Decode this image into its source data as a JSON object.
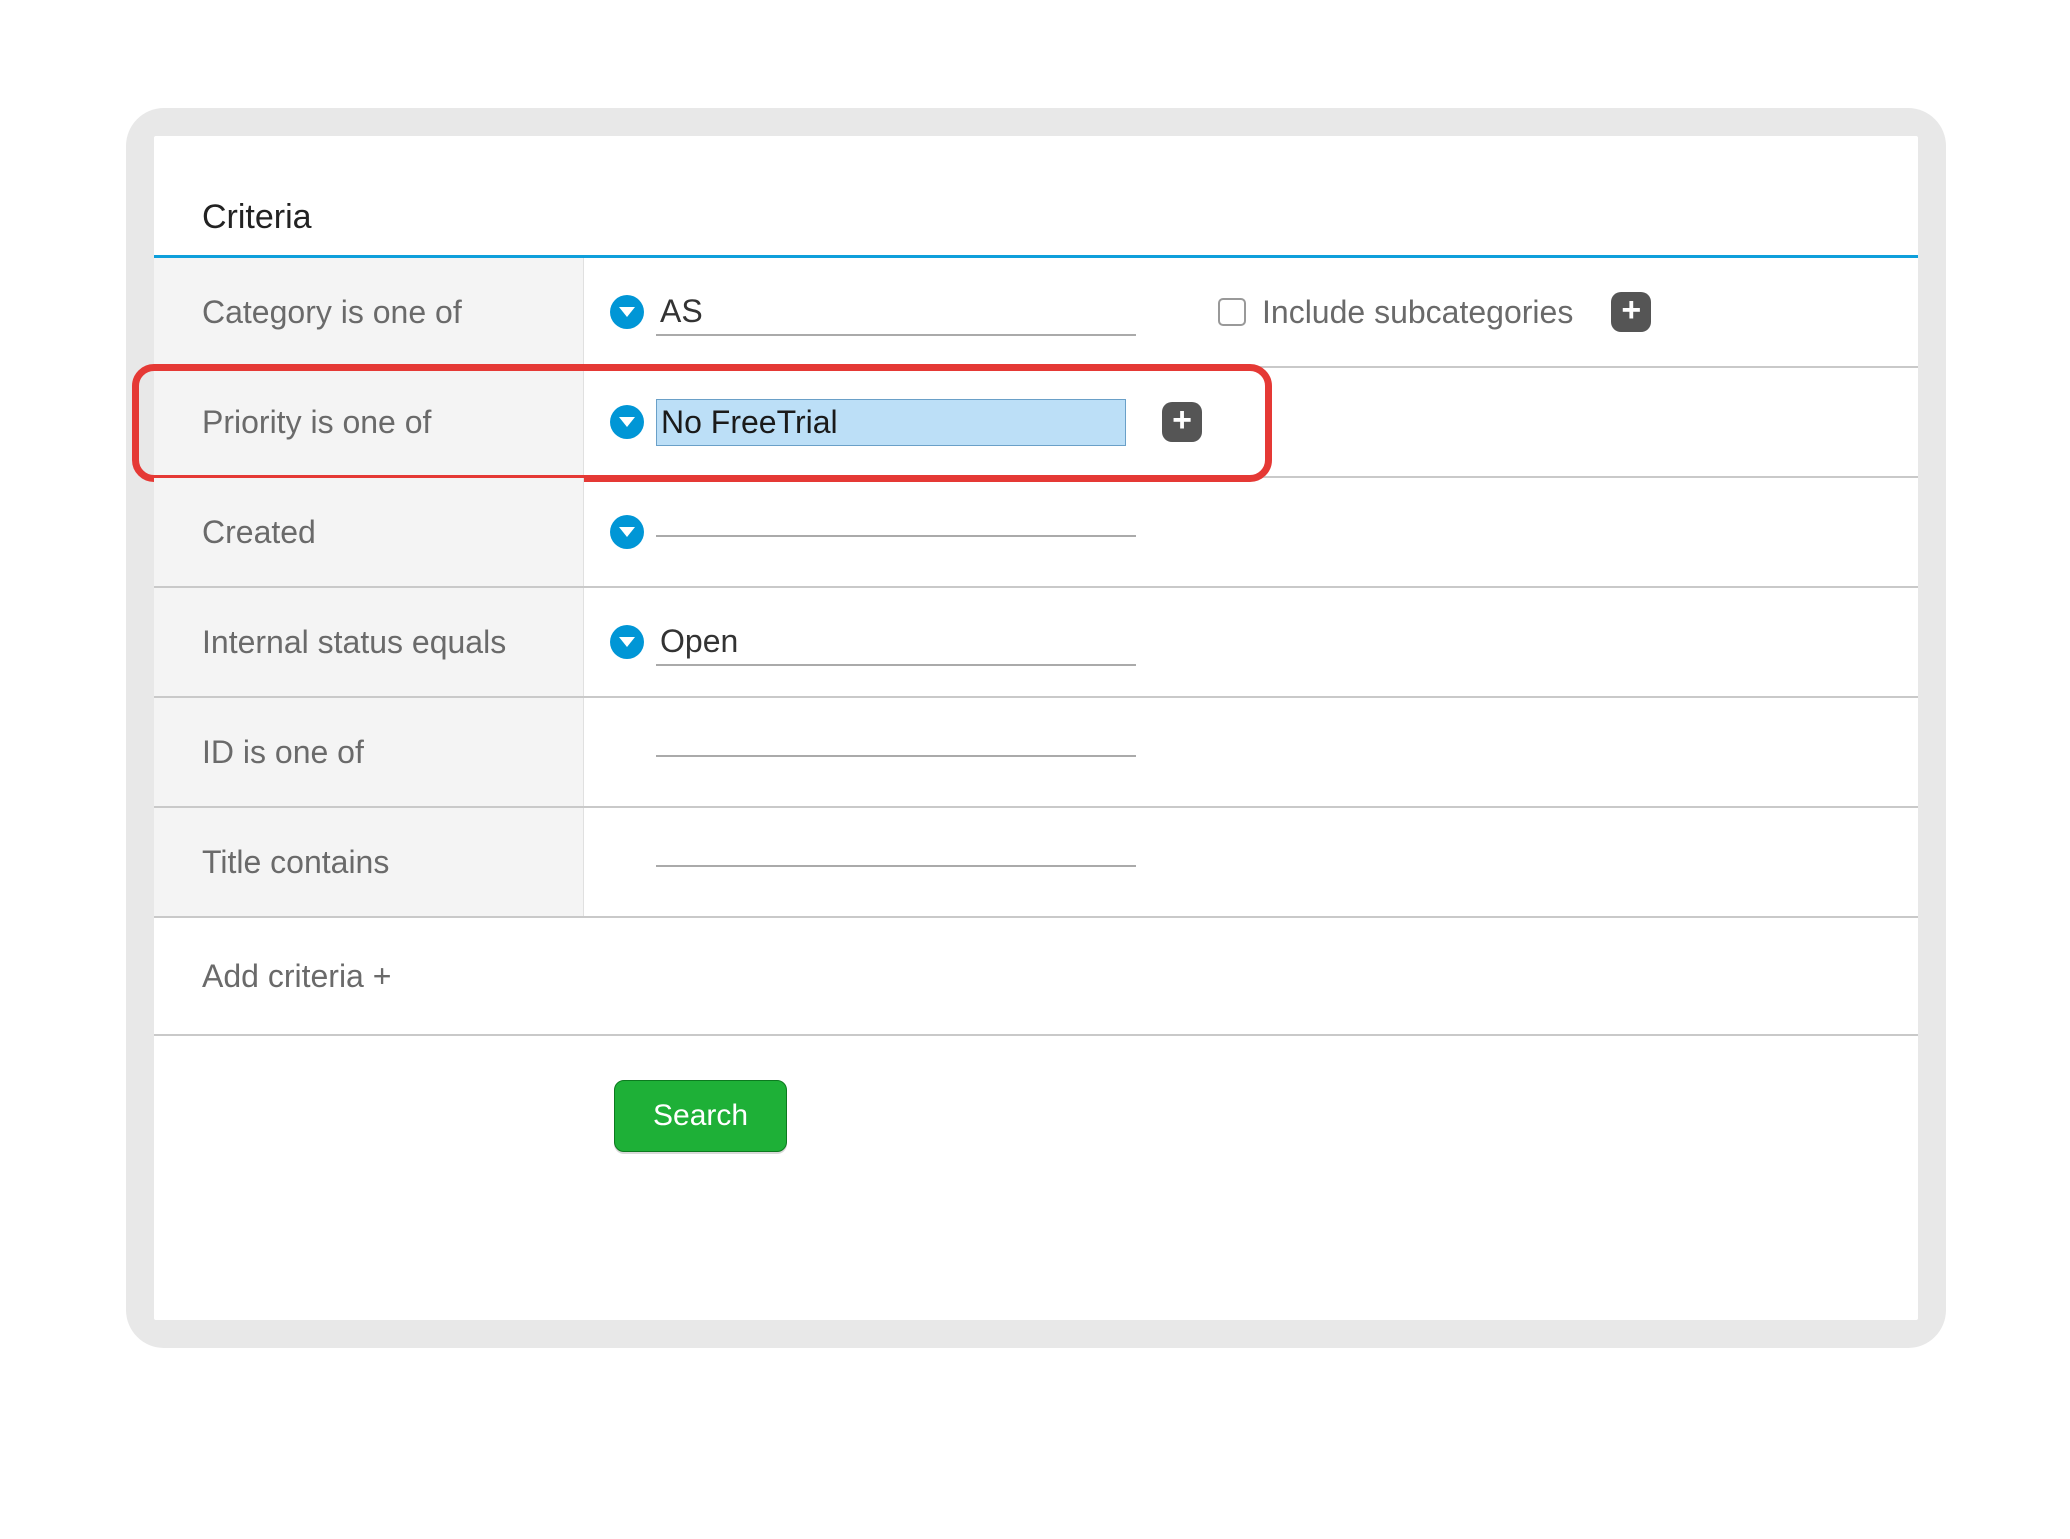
{
  "section_title": "Criteria",
  "rows": {
    "category": {
      "label": "Category is one of",
      "value": "AS",
      "include_sub_label": "Include subcategories"
    },
    "priority": {
      "label": "Priority is one of",
      "value": "No FreeTrial"
    },
    "created": {
      "label": "Created",
      "value": ""
    },
    "internal_status": {
      "label": "Internal status equals",
      "value": "Open"
    },
    "id": {
      "label": "ID is one of",
      "value": ""
    },
    "title": {
      "label": "Title contains",
      "value": ""
    }
  },
  "add_criteria_label": "Add criteria +",
  "search_button_label": "Search"
}
